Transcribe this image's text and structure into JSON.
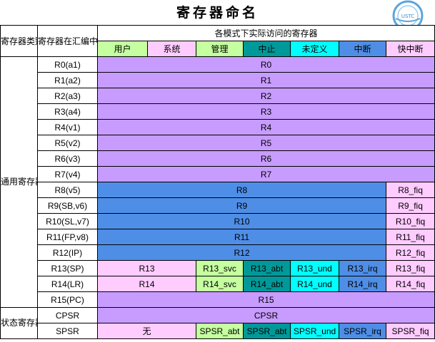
{
  "title": "寄存器命名",
  "logo_text": "USTC",
  "headers": {
    "category": "寄存器类别",
    "asm_name": "寄存器在汇编中的名称",
    "modes_title": "各模式下实际访问的寄存器",
    "modes": [
      "用户",
      "系统",
      "管理",
      "中止",
      "未定义",
      "中断",
      "快中断"
    ]
  },
  "categories": {
    "general": "通用寄存器和程序计数器",
    "status": "状态寄存器"
  },
  "rows": [
    {
      "name": "R0(a1)",
      "cells": [
        "R0"
      ]
    },
    {
      "name": "R1(a2)",
      "cells": [
        "R1"
      ]
    },
    {
      "name": "R2(a3)",
      "cells": [
        "R2"
      ]
    },
    {
      "name": "R3(a4)",
      "cells": [
        "R3"
      ]
    },
    {
      "name": "R4(v1)",
      "cells": [
        "R4"
      ]
    },
    {
      "name": "R5(v2)",
      "cells": [
        "R5"
      ]
    },
    {
      "name": "R6(v3)",
      "cells": [
        "R6"
      ]
    },
    {
      "name": "R7(v4)",
      "cells": [
        "R7"
      ]
    },
    {
      "name": "R8(v5)",
      "cells": [
        "R8",
        "R8_fiq"
      ]
    },
    {
      "name": "R9(SB,v6)",
      "cells": [
        "R9",
        "R9_fiq"
      ]
    },
    {
      "name": "R10(SL,v7)",
      "cells": [
        "R10",
        "R10_fiq"
      ]
    },
    {
      "name": "R11(FP,v8)",
      "cells": [
        "R11",
        "R11_fiq"
      ]
    },
    {
      "name": "R12(IP)",
      "cells": [
        "R12",
        "R12_fiq"
      ]
    },
    {
      "name": "R13(SP)",
      "cells": [
        "R13",
        "R13_svc",
        "R13_abt",
        "R13_und",
        "R13_irq",
        "R13_fiq"
      ]
    },
    {
      "name": "R14(LR)",
      "cells": [
        "R14",
        "R14_svc",
        "R14_abt",
        "R14_und",
        "R14_irq",
        "R14_fiq"
      ]
    },
    {
      "name": "R15(PC)",
      "cells": [
        "R15"
      ]
    },
    {
      "name": "CPSR",
      "cells": [
        "CPSR"
      ]
    },
    {
      "name": "SPSR",
      "cells": [
        "无",
        "SPSR_abt",
        "SPSR_abt",
        "SPSR_und",
        "SPSR_irq",
        "SPSR_fiq"
      ]
    }
  ],
  "colors": {
    "purple": "#c79cfe",
    "blue": "#4f8ee6",
    "pink": "#ffccff",
    "green": "#c5ffa0",
    "teal": "#009999",
    "cyan": "#00ffff"
  }
}
